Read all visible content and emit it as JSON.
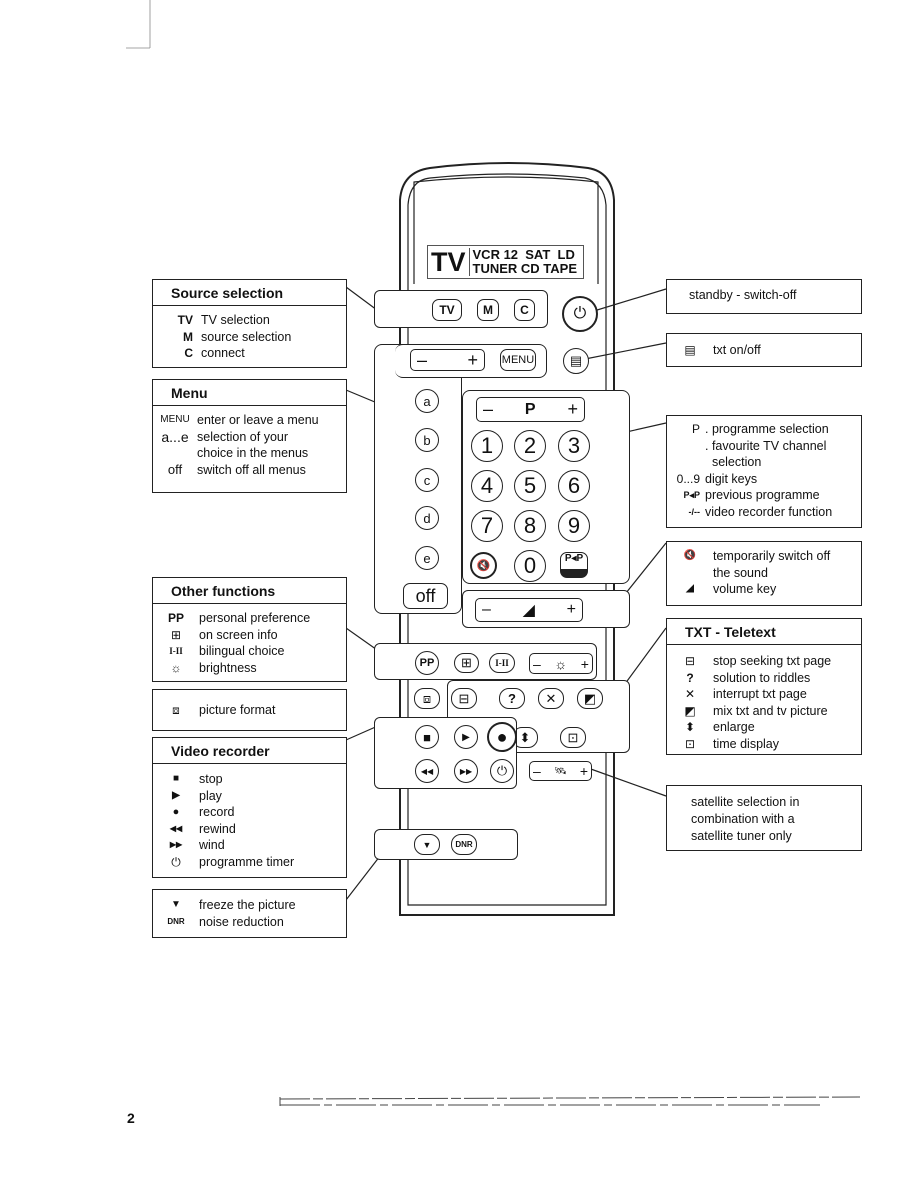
{
  "page_number": "2",
  "remote": {
    "display": {
      "tv": "TV",
      "row1": "VCR 12  SAT  LD",
      "row2": "TUNER CD TAPE"
    },
    "buttons": {
      "tv": "TV",
      "m": "M",
      "c": "C",
      "menu": "MENU",
      "minus": "–",
      "plus": "+",
      "p": "P",
      "a": "a",
      "b": "b",
      "c_small": "c",
      "d": "d",
      "e": "e",
      "off": "off",
      "digits": [
        "1",
        "2",
        "3",
        "4",
        "5",
        "6",
        "7",
        "8",
        "9",
        "0"
      ],
      "pp": "PP",
      "bilingual": "I-II",
      "dnr": "DNR",
      "p_p": "P◂P"
    },
    "icons": {
      "power": "⏻",
      "txt": "▤",
      "mute": "🔇",
      "volume": "◢",
      "info": "⊞",
      "brightness": "☼",
      "format": "⧈",
      "stop_seek": "⊟",
      "riddle": "?",
      "interrupt": "✕",
      "mix": "◩",
      "enlarge": "⬍",
      "time": "⊡",
      "stop": "■",
      "play": "▶",
      "record": "●",
      "rewind": "◀◀",
      "wind": "▶▶",
      "timer": "⏻",
      "satellite": "🛰",
      "freeze": "▼"
    }
  },
  "source_selection": {
    "title": "Source selection",
    "items": [
      {
        "key": "TV",
        "text": "TV selection"
      },
      {
        "key": "M",
        "text": "source selection"
      },
      {
        "key": "C",
        "text": "connect"
      }
    ]
  },
  "menu": {
    "title": "Menu",
    "items": [
      {
        "key": "MENU",
        "text": "enter or leave a menu"
      },
      {
        "key": "a...e",
        "text": "selection of your"
      },
      {
        "key": "",
        "text": "choice in the menus"
      },
      {
        "key": "off",
        "text": "switch off all menus"
      }
    ]
  },
  "other_functions": {
    "title": "Other functions",
    "items": [
      {
        "key": "PP",
        "text": "personal preference"
      },
      {
        "key": "⊞",
        "text": "on screen info"
      },
      {
        "key": "I-II",
        "text": "bilingual choice"
      },
      {
        "key": "☼",
        "text": "brightness"
      }
    ]
  },
  "picture_format": {
    "key": "⧈",
    "text": "picture format"
  },
  "video_recorder": {
    "title": "Video recorder",
    "items": [
      {
        "key": "■",
        "text": "stop"
      },
      {
        "key": "▶",
        "text": "play"
      },
      {
        "key": "●",
        "text": "record"
      },
      {
        "key": "◀◀",
        "text": "rewind"
      },
      {
        "key": "▶▶",
        "text": "wind"
      },
      {
        "key": "⏻",
        "text": "programme timer"
      }
    ]
  },
  "freeze": {
    "items": [
      {
        "key": "▼",
        "text": "freeze the picture"
      },
      {
        "key": "DNR",
        "text": "noise reduction"
      }
    ]
  },
  "standby": {
    "text": "standby - switch-off"
  },
  "txt_onoff": {
    "key": "▤",
    "text": "txt on/off"
  },
  "programme": {
    "items": [
      {
        "key": "P",
        "text": ". programme selection"
      },
      {
        "key": "",
        "text": ". favourite TV channel"
      },
      {
        "key": "",
        "text": "  selection"
      },
      {
        "key": "0...9",
        "text": "digit keys"
      },
      {
        "key": "P◂P",
        "text": "previous programme"
      },
      {
        "key": "-/--",
        "text": "video recorder function"
      }
    ]
  },
  "sound": {
    "items": [
      {
        "key": "🔇",
        "text": "temporarily switch off"
      },
      {
        "key": "",
        "text": "the sound"
      },
      {
        "key": "◢",
        "text": "volume key"
      }
    ]
  },
  "teletext": {
    "title": "TXT - Teletext",
    "items": [
      {
        "key": "⊟",
        "text": "stop seeking txt page"
      },
      {
        "key": "?",
        "text": "solution to riddles"
      },
      {
        "key": "✕",
        "text": "interrupt txt page"
      },
      {
        "key": "◩",
        "text": "mix txt and tv picture"
      },
      {
        "key": "⬍",
        "text": "enlarge"
      },
      {
        "key": "⊡",
        "text": "time display"
      }
    ]
  },
  "satellite": {
    "lines": [
      "satellite selection in",
      "combination with a",
      "satellite tuner only"
    ]
  }
}
